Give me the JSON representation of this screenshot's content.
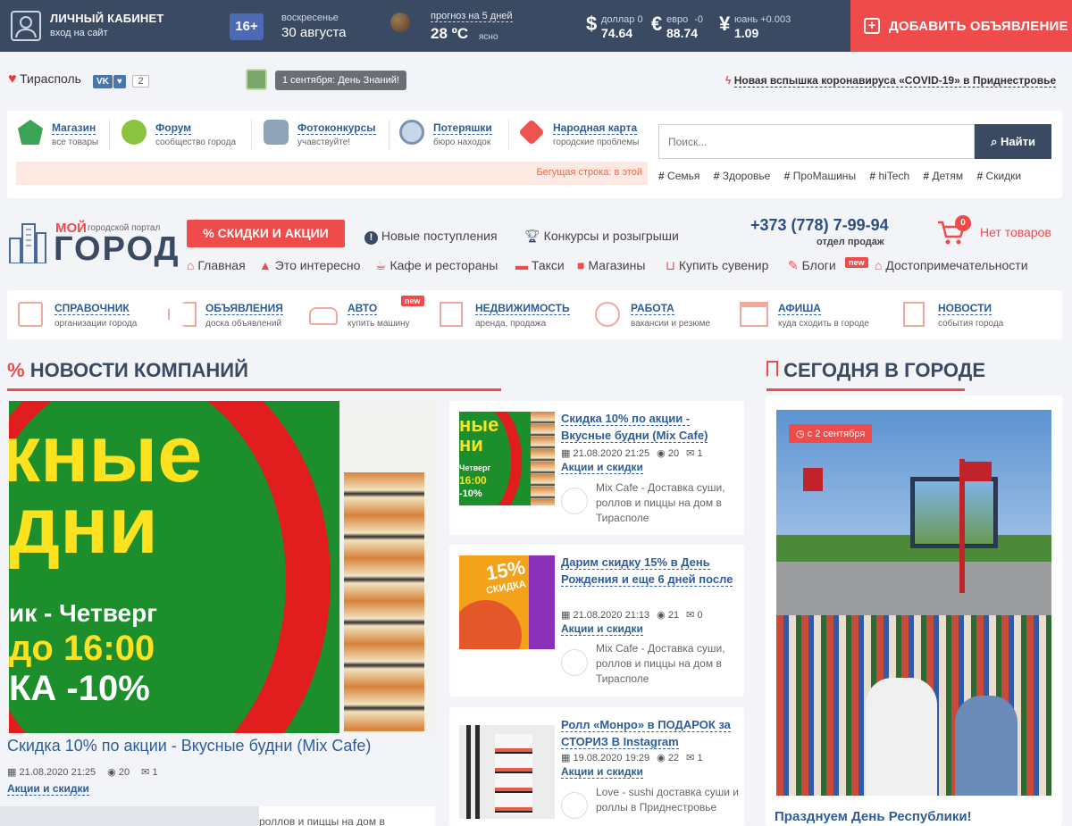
{
  "topbar": {
    "cabinet_title": "ЛИЧНЫЙ КАБИНЕТ",
    "cabinet_sub": "вход на сайт",
    "age": "16+",
    "weekday": "воскресенье",
    "date": "30 августа",
    "forecast_label": "прогноз на 5 дней",
    "temperature": "28 ºC",
    "sky": "ясно",
    "currencies": [
      {
        "symbol": "$",
        "name": "доллар",
        "change": "0",
        "value": "74.64"
      },
      {
        "symbol": "€",
        "name": "евро",
        "change": "-0",
        "value": "88.74"
      },
      {
        "symbol": "¥",
        "name": "юань",
        "change": "+0.003",
        "value": "1.09"
      }
    ],
    "add_button": "ДОБАВИТЬ ОБЪЯВЛЕНИЕ"
  },
  "bar2": {
    "city": "Тирасполь",
    "vk": "VK",
    "likes": "2",
    "event": "1 сентября: День Знаний!",
    "headline": "Новая вспышка коронавируса «COVID-19» в Приднестровье"
  },
  "services": [
    {
      "title": "Магазин",
      "sub": "все товары"
    },
    {
      "title": "Форум",
      "sub": "сообщество города"
    },
    {
      "title": "Фотоконкурсы",
      "sub": "учавствуйте!"
    },
    {
      "title": "Потеряшки",
      "sub": "бюро находок"
    },
    {
      "title": "Народная карта",
      "sub": "городские проблемы"
    }
  ],
  "search": {
    "placeholder": "Поиск...",
    "button": "Найти"
  },
  "ticker": "Бегущая строка: в этой",
  "tags": [
    "Семья",
    "Здоровье",
    "ПроМашины",
    "hiTech",
    "Детям",
    "Скидки"
  ],
  "logo": {
    "moi": "МОЙ",
    "portal": "городской портал",
    "gorod": "ГОРОД"
  },
  "promo": "СКИДКИ И АКЦИИ",
  "topnav": [
    "Новые поступления",
    "Конкурсы и розыгрыши"
  ],
  "nav2": [
    "Главная",
    "Это интересно",
    "Кафе и рестораны",
    "Такси",
    "Магазины",
    "Купить сувенир",
    "Блоги",
    "Достопримечательности"
  ],
  "new_badge": "new",
  "phone": "+373 (778) 7-99-94",
  "phone_sub": "отдел продаж",
  "cart": {
    "count": "0",
    "label": "Нет товаров"
  },
  "cats": [
    {
      "title": "СПРАВОЧНИК",
      "sub": "организации города"
    },
    {
      "title": "ОБЪЯВЛЕНИЯ",
      "sub": "доска объявлений"
    },
    {
      "title": "АВТО",
      "sub": "купить машину"
    },
    {
      "title": "НЕДВИЖИМОСТЬ",
      "sub": "аренда, продажа"
    },
    {
      "title": "РАБОТА",
      "sub": "вакансии и резюме"
    },
    {
      "title": "АФИША",
      "sub": "куда сходить в городе"
    },
    {
      "title": "НОВОСТИ",
      "sub": "события города"
    }
  ],
  "news_title": "НОВОСТИ КОМПАНИЙ",
  "today_title": "СЕГОДНЯ В ГОРОДЕ",
  "hero": {
    "caption": "Скидка 10% по акции - Вкусные будни (Mix Cafe)",
    "date": "21.08.2020 21:25",
    "views": "20",
    "comments": "1",
    "category": "Акции и скидки",
    "img_line1": "кные",
    "img_line2": "дни",
    "img_line3": "ик - Четверг",
    "img_line4": "до 16:00",
    "img_line5": "КА -10%",
    "bottom_text": "роллов и пиццы на дом в"
  },
  "cards": [
    {
      "title": "Скидка 10% по акции - Вкусные будни (Mix Cafe)",
      "date": "21.08.2020 21:25",
      "views": "20",
      "comments": "1",
      "category": "Акции и скидки",
      "source": "Mix Cafe - Доставка суши, роллов и пиццы на дом в Тирасполе"
    },
    {
      "title": "Дарим скидку 15% в День Рождения и еще 6 дней после",
      "date": "21.08.2020 21:13",
      "views": "21",
      "comments": "0",
      "category": "Акции и скидки",
      "source": "Mix Cafe - Доставка суши, роллов и пиццы на дом в Тирасполе"
    },
    {
      "title": "Ролл «Монро» в ПОДАРОК за СТОРИЗ В Instagram",
      "date": "19.08.2020 19:29",
      "views": "22",
      "comments": "1",
      "category": "Акции и скидки",
      "source": "Love - sushi доставка суши и роллы в Приднестровье"
    }
  ],
  "thumb_texts": {
    "t1a": "ные",
    "t1b": "ни",
    "t1c": "Четверг",
    "t1d": "16:00",
    "t1e": "-10%",
    "t2a": "15%",
    "t2b": "СКИДКА"
  },
  "today": {
    "badge": "с 2 сентября",
    "caption": "Празднуем День Республики!"
  }
}
